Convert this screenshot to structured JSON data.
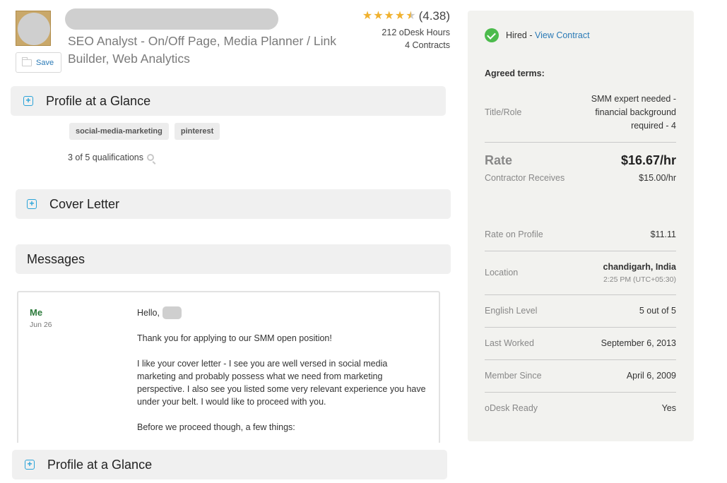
{
  "header": {
    "headline": "SEO Analyst - On/Off Page, Media Planner / Link Builder, Web Analytics",
    "save_label": "Save",
    "rating_value": "(4.38)",
    "rating_stars": 4.38,
    "hours": "212 oDesk Hours",
    "contracts": "4 Contracts"
  },
  "sections": {
    "profile_glance_top": "Profile at a Glance",
    "cover_letter": "Cover Letter",
    "messages": "Messages",
    "profile_glance_bottom": "Profile at a Glance"
  },
  "profile": {
    "tags": [
      "social-media-marketing",
      "pinterest"
    ],
    "qualifications": "3 of 5 qualifications"
  },
  "message": {
    "sender": "Me",
    "date": "Jun 26",
    "greeting": "Hello,",
    "p1": "Thank you for applying to our SMM open position!",
    "p2": "I like your cover letter - I see you are well versed in social media marketing and probably possess what we need from marketing perspective. I also see you listed some very relevant experience you have under your belt. I would like to proceed with you.",
    "p3": "Before we proceed though, a few things:"
  },
  "panel": {
    "hired_label": "Hired - ",
    "view_contract": "View Contract",
    "agreed_terms": "Agreed terms:",
    "title_role_label": "Title/Role",
    "title_role_value": "SMM expert needed - financial background required - 4",
    "rate_label": "Rate",
    "rate_value": "$16.67/hr",
    "contractor_label": "Contractor Receives",
    "contractor_value": "$15.00/hr",
    "rate_profile_label": "Rate on Profile",
    "rate_profile_value": "$11.11",
    "location_label": "Location",
    "location_value": "chandigarh, India",
    "location_time": "2:25 PM (UTC+05:30)",
    "english_label": "English Level",
    "english_value": "5 out of 5",
    "last_worked_label": "Last Worked",
    "last_worked_value": "September 6, 2013",
    "member_since_label": "Member Since",
    "member_since_value": "April 6, 2009",
    "odesk_ready_label": "oDesk Ready",
    "odesk_ready_value": "Yes"
  },
  "colors": {
    "link": "#2a7ab6",
    "star": "#f0b12e",
    "hired_check": "#4cbb4c",
    "plus_icon": "#2aa3d8"
  }
}
